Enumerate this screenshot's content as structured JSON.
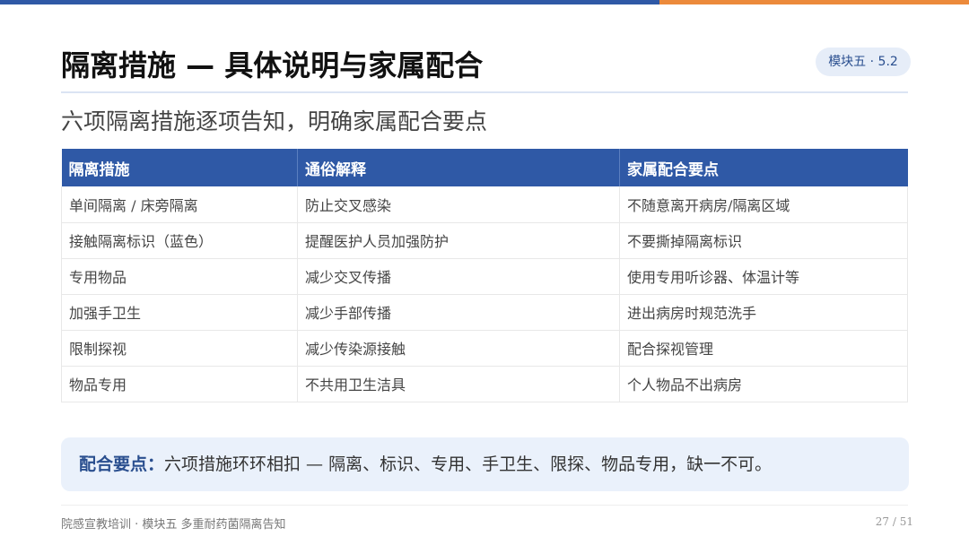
{
  "header": {
    "title": "隔离措施 — 具体说明与家属配合",
    "badge": "模块五 · 5.2",
    "subtitle": "六项隔离措施逐项告知，明确家属配合要点"
  },
  "table": {
    "columns": [
      "隔离措施",
      "通俗解释",
      "家属配合要点"
    ],
    "rows": [
      [
        "单间隔离 / 床旁隔离",
        "防止交叉感染",
        "不随意离开病房/隔离区域"
      ],
      [
        "接触隔离标识（蓝色）",
        "提醒医护人员加强防护",
        "不要撕掉隔离标识"
      ],
      [
        "专用物品",
        "减少交叉传播",
        "使用专用听诊器、体温计等"
      ],
      [
        "加强手卫生",
        "减少手部传播",
        "进出病房时规范洗手"
      ],
      [
        "限制探视",
        "减少传染源接触",
        "配合探视管理"
      ],
      [
        "物品专用",
        "不共用卫生洁具",
        "个人物品不出病房"
      ]
    ]
  },
  "note": {
    "label": "配合要点：",
    "text": "六项措施环环相扣 — 隔离、标识、专用、手卫生、限探、物品专用，缺一不可。"
  },
  "footer": {
    "left": "院感宣教培训 · 模块五 多重耐药菌隔离告知",
    "page": "27 / 51"
  },
  "colors": {
    "primary": "#2f59a6",
    "accent": "#ec8a3b",
    "note_bg": "#eaf1fb"
  }
}
